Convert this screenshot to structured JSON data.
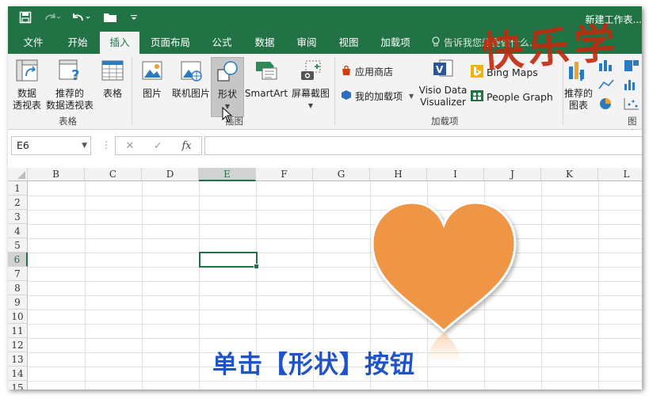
{
  "title_bar": {
    "doc_title": "新建工作表..."
  },
  "menu_tabs": [
    {
      "label": "文件"
    },
    {
      "label": "开始"
    },
    {
      "label": "插入",
      "active": true
    },
    {
      "label": "页面布局"
    },
    {
      "label": "公式"
    },
    {
      "label": "数据"
    },
    {
      "label": "审阅"
    },
    {
      "label": "视图"
    },
    {
      "label": "加载项"
    }
  ],
  "tell_me": "告诉我您想要做什么...",
  "ribbon": {
    "tables_group": {
      "label": "表格",
      "pivot_table": "数据\n透视表",
      "pivot_table_l1": "数据",
      "pivot_table_l2": "透视表",
      "recommended_pivot_l1": "推荐的",
      "recommended_pivot_l2": "数据透视表",
      "table": "表格"
    },
    "illustrations_group": {
      "label": "插图",
      "pictures": "图片",
      "online_pictures": "联机图片",
      "shapes": "形状",
      "smartart": "SmartArt",
      "screenshot": "屏幕截图"
    },
    "addins_group": {
      "label": "加载项",
      "store": "应用商店",
      "my_addins": "我的加载项",
      "visio_l1": "Visio Data",
      "visio_l2": "Visualizer",
      "bing_maps": "Bing Maps",
      "people_graph": "People Graph"
    },
    "charts_group": {
      "label": "图表",
      "recommended_charts_l1": "推荐的",
      "recommended_charts_l2": "图表"
    }
  },
  "formula_bar": {
    "name_box": "E6",
    "fx_label": "fx",
    "formula_value": ""
  },
  "columns": [
    "B",
    "C",
    "D",
    "E",
    "F",
    "G",
    "H",
    "I",
    "J",
    "K",
    "L"
  ],
  "rows": [
    "1",
    "2",
    "3",
    "4",
    "5",
    "6",
    "7",
    "8",
    "9",
    "10",
    "11",
    "12",
    "13",
    "14",
    "15"
  ],
  "selected_cell": {
    "column": "E",
    "row": "6"
  },
  "caption": "单击【形状】按钮",
  "watermark_text": "快乐学",
  "colors": {
    "excel_green": "#217346",
    "heart_orange": "#ef9646",
    "caption_blue": "#1f54c9",
    "watermark_red": "#c0290f"
  }
}
